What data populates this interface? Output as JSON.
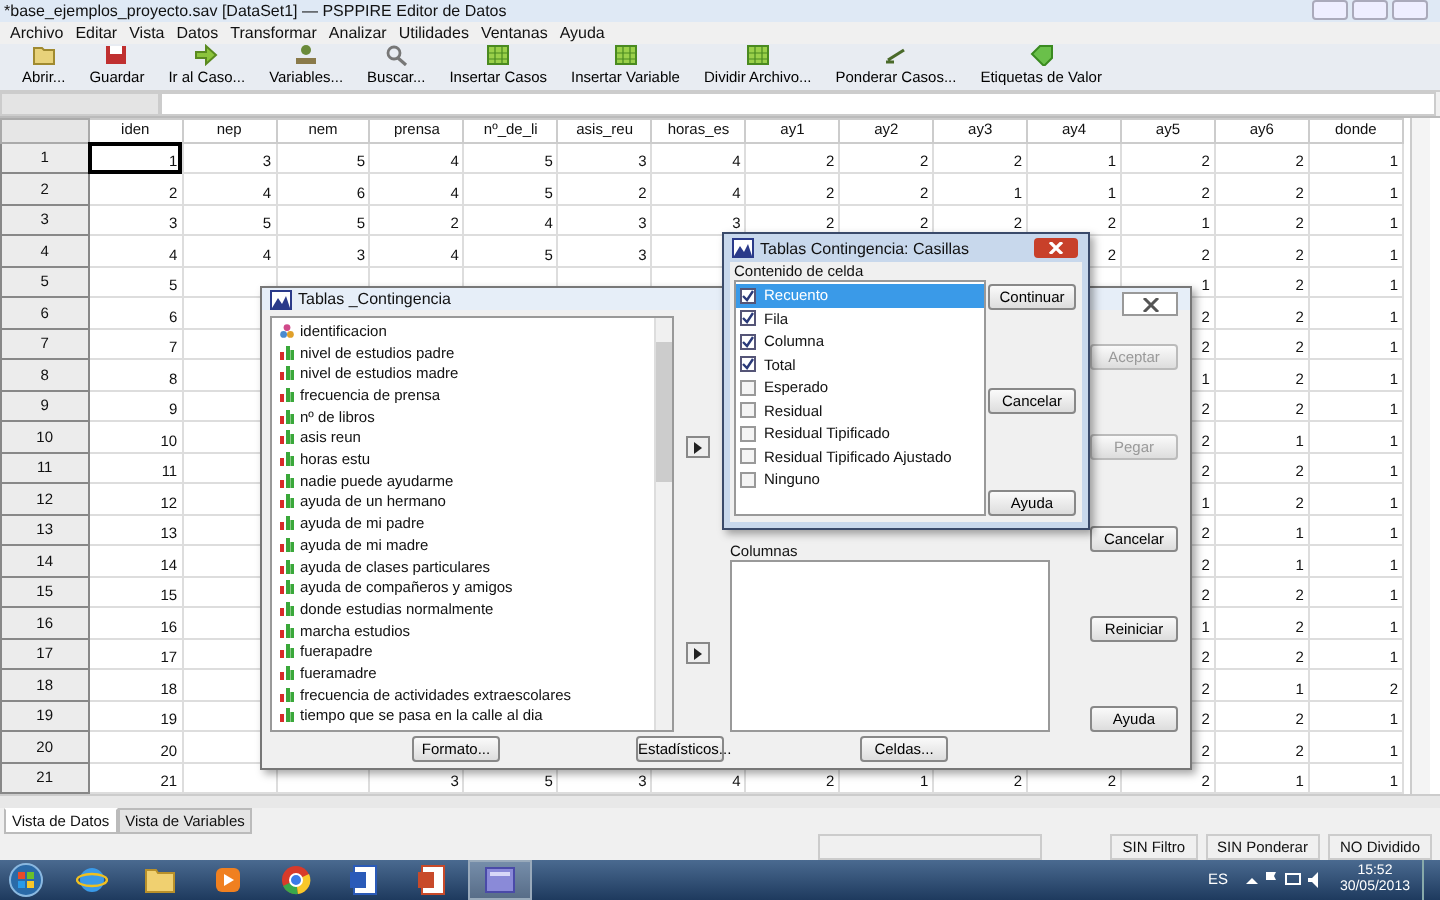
{
  "window": {
    "title": "*base_ejemplos_proyecto.sav [DataSet1] — PSPPIRE Editor de Datos"
  },
  "menu": [
    "Archivo",
    "Editar",
    "Vista",
    "Datos",
    "Transformar",
    "Analizar",
    "Utilidades",
    "Ventanas",
    "Ayuda"
  ],
  "toolbar": [
    {
      "label": "Abrir...",
      "kind": "open"
    },
    {
      "label": "Guardar",
      "kind": "save"
    },
    {
      "label": "Ir al Caso...",
      "kind": "goto"
    },
    {
      "label": "Variables...",
      "kind": "variables"
    },
    {
      "label": "Buscar...",
      "kind": "find"
    },
    {
      "label": "Insertar Casos",
      "kind": "insert"
    },
    {
      "label": "Insertar Variable",
      "kind": "insert"
    },
    {
      "label": "Dividir Archivo...",
      "kind": "split"
    },
    {
      "label": "Ponderar Casos...",
      "kind": "weight"
    },
    {
      "label": "Etiquetas de Valor",
      "kind": "labels"
    }
  ],
  "grid": {
    "columns": [
      "iden",
      "nep",
      "nem",
      "prensa",
      "nº_de_li",
      "asis_reu",
      "horas_es",
      "ay1",
      "ay2",
      "ay3",
      "ay4",
      "ay5",
      "ay6",
      "donde"
    ],
    "rows": [
      {
        "label": "1",
        "cells": [
          "1",
          "3",
          "5",
          "4",
          "5",
          "3",
          "4",
          "2",
          "2",
          "2",
          "1",
          "2",
          "2",
          "1"
        ]
      },
      {
        "label": "2",
        "cells": [
          "2",
          "4",
          "6",
          "4",
          "5",
          "2",
          "4",
          "2",
          "2",
          "1",
          "1",
          "2",
          "2",
          "1"
        ]
      },
      {
        "label": "3",
        "cells": [
          "3",
          "5",
          "5",
          "2",
          "4",
          "3",
          "3",
          "2",
          "2",
          "2",
          "2",
          "1",
          "2",
          "1"
        ]
      },
      {
        "label": "4",
        "cells": [
          "4",
          "4",
          "3",
          "4",
          "5",
          "3",
          null,
          null,
          null,
          null,
          "2",
          "2",
          "2",
          "1"
        ]
      },
      {
        "label": "5",
        "cells": [
          "5",
          null,
          null,
          null,
          null,
          null,
          null,
          null,
          null,
          null,
          null,
          "1",
          "2",
          "1"
        ]
      },
      {
        "label": "6",
        "cells": [
          "6",
          null,
          null,
          null,
          null,
          null,
          null,
          null,
          null,
          null,
          null,
          "2",
          "2",
          "1"
        ]
      },
      {
        "label": "7",
        "cells": [
          "7",
          null,
          null,
          null,
          null,
          null,
          null,
          null,
          null,
          null,
          null,
          "2",
          "2",
          "1"
        ]
      },
      {
        "label": "8",
        "cells": [
          "8",
          null,
          null,
          null,
          null,
          null,
          null,
          null,
          null,
          null,
          null,
          "1",
          "2",
          "1"
        ]
      },
      {
        "label": "9",
        "cells": [
          "9",
          null,
          null,
          null,
          null,
          null,
          null,
          null,
          null,
          null,
          null,
          "2",
          "2",
          "1"
        ]
      },
      {
        "label": "10",
        "cells": [
          "10",
          null,
          null,
          null,
          null,
          null,
          null,
          null,
          null,
          null,
          null,
          "2",
          "1",
          "1"
        ]
      },
      {
        "label": "11",
        "cells": [
          "11",
          null,
          null,
          null,
          null,
          null,
          null,
          null,
          null,
          null,
          null,
          "2",
          "2",
          "1"
        ]
      },
      {
        "label": "12",
        "cells": [
          "12",
          null,
          null,
          null,
          null,
          null,
          null,
          null,
          null,
          null,
          null,
          "1",
          "2",
          "1"
        ]
      },
      {
        "label": "13",
        "cells": [
          "13",
          null,
          null,
          null,
          null,
          null,
          null,
          null,
          null,
          null,
          null,
          "2",
          "1",
          "1"
        ]
      },
      {
        "label": "14",
        "cells": [
          "14",
          null,
          null,
          null,
          null,
          null,
          null,
          null,
          null,
          null,
          null,
          "2",
          "1",
          "1"
        ]
      },
      {
        "label": "15",
        "cells": [
          "15",
          null,
          null,
          null,
          null,
          null,
          null,
          null,
          null,
          null,
          null,
          "2",
          "2",
          "1"
        ]
      },
      {
        "label": "16",
        "cells": [
          "16",
          null,
          null,
          null,
          null,
          null,
          null,
          null,
          null,
          null,
          null,
          "1",
          "2",
          "1"
        ]
      },
      {
        "label": "17",
        "cells": [
          "17",
          null,
          null,
          null,
          null,
          null,
          null,
          null,
          null,
          null,
          null,
          "2",
          "2",
          "1"
        ]
      },
      {
        "label": "18",
        "cells": [
          "18",
          null,
          null,
          null,
          null,
          null,
          null,
          null,
          null,
          null,
          null,
          "2",
          "1",
          "2"
        ]
      },
      {
        "label": "19",
        "cells": [
          "19",
          null,
          null,
          null,
          null,
          null,
          null,
          null,
          null,
          null,
          null,
          "2",
          "2",
          "1"
        ]
      },
      {
        "label": "20",
        "cells": [
          "20",
          null,
          null,
          null,
          null,
          null,
          null,
          null,
          null,
          null,
          null,
          "2",
          "2",
          "1"
        ]
      },
      {
        "label": "21",
        "cells": [
          "21",
          null,
          null,
          "3",
          "5",
          "3",
          "4",
          "2",
          "1",
          "2",
          "2",
          "2",
          "1",
          "1"
        ]
      }
    ]
  },
  "sheet_tabs": [
    {
      "label": "Vista de Datos",
      "selected": true
    },
    {
      "label": "Vista de Variables",
      "selected": false
    }
  ],
  "status_bar": [
    "SIN Filtro",
    "SIN Ponderar",
    "NO Dividido"
  ],
  "dialog": {
    "title": "Tablas _Contingencia",
    "variables": [
      {
        "label": "identificacion",
        "kind": "nominal"
      },
      {
        "label": "nivel de estudios padre",
        "kind": "ordinal"
      },
      {
        "label": "nivel de estudios madre",
        "kind": "ordinal"
      },
      {
        "label": "frecuencia de prensa",
        "kind": "ordinal"
      },
      {
        "label": "nº de libros",
        "kind": "ordinal"
      },
      {
        "label": "asis reun",
        "kind": "ordinal"
      },
      {
        "label": "horas estu",
        "kind": "ordinal"
      },
      {
        "label": "nadie puede ayudarme",
        "kind": "ordinal"
      },
      {
        "label": "ayuda de un hermano",
        "kind": "ordinal"
      },
      {
        "label": "ayuda de mi padre",
        "kind": "ordinal"
      },
      {
        "label": "ayuda de mi madre",
        "kind": "ordinal"
      },
      {
        "label": "ayuda de clases particulares",
        "kind": "ordinal"
      },
      {
        "label": "ayuda de compañeros y amigos",
        "kind": "ordinal"
      },
      {
        "label": "donde estudias normalmente",
        "kind": "ordinal"
      },
      {
        "label": "marcha estudios",
        "kind": "ordinal"
      },
      {
        "label": "fuerapadre",
        "kind": "ordinal"
      },
      {
        "label": "fueramadre",
        "kind": "ordinal"
      },
      {
        "label": "frecuencia de actividades extraescolares",
        "kind": "ordinal"
      },
      {
        "label": "tiempo que se pasa en la calle al dia",
        "kind": "ordinal"
      }
    ],
    "columns_label": "Columnas",
    "side_buttons": [
      {
        "label": "Aceptar",
        "disabled": true
      },
      {
        "label": "Pegar",
        "disabled": true
      },
      {
        "label": "Cancelar",
        "disabled": false
      },
      {
        "label": "Reiniciar",
        "disabled": false
      },
      {
        "label": "Ayuda",
        "disabled": false
      }
    ],
    "bottom_buttons": [
      "Formato...",
      "Estadísticos...",
      "Celdas..."
    ]
  },
  "cells_dialog": {
    "title": "Tablas Contingencia: Casillas",
    "group_label": "Contenido de celda",
    "options": [
      {
        "label": "Recuento",
        "checked": true,
        "selected": true
      },
      {
        "label": "Fila",
        "checked": true,
        "selected": false
      },
      {
        "label": "Columna",
        "checked": true,
        "selected": false
      },
      {
        "label": "Total",
        "checked": true,
        "selected": false
      },
      {
        "label": "Esperado",
        "checked": false,
        "selected": false
      },
      {
        "label": "Residual",
        "checked": false,
        "selected": false
      },
      {
        "label": "Residual Tipificado",
        "checked": false,
        "selected": false
      },
      {
        "label": "Residual Tipificado Ajustado",
        "checked": false,
        "selected": false
      },
      {
        "label": "Ninguno",
        "checked": false,
        "selected": false
      }
    ],
    "buttons": [
      "Continuar",
      "Cancelar",
      "Ayuda"
    ]
  },
  "taskbar": {
    "apps": [
      {
        "kind": "browser",
        "selected": false
      },
      {
        "kind": "folder",
        "selected": false
      },
      {
        "kind": "media",
        "selected": false
      },
      {
        "kind": "chrome",
        "selected": false
      },
      {
        "kind": "word",
        "selected": false
      },
      {
        "kind": "slides",
        "selected": false
      },
      {
        "kind": "pspp",
        "selected": true
      }
    ],
    "language": "ES",
    "time": "15:52",
    "date": "30/05/2013"
  }
}
